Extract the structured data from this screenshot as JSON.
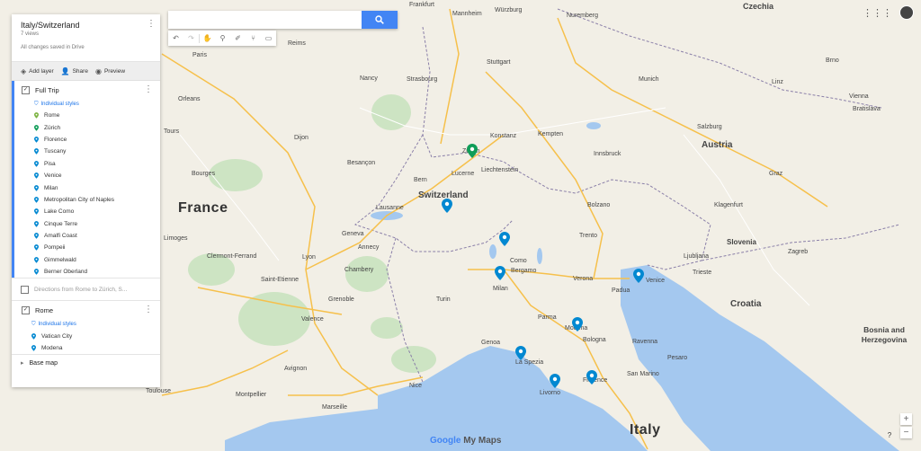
{
  "map_title": "Italy/Switzerland",
  "views": "7 views",
  "save_status": "All changes saved in Drive",
  "toolbar": {
    "add_layer": "Add layer",
    "share": "Share",
    "preview": "Preview"
  },
  "layers": [
    {
      "title": "Full Trip",
      "styles_label": "Individual styles",
      "items": [
        {
          "label": "Rome",
          "color": "#7cb342"
        },
        {
          "label": "Zürich",
          "color": "#0f9d58"
        },
        {
          "label": "Florence",
          "color": "#0288d1"
        },
        {
          "label": "Tuscany",
          "color": "#0288d1"
        },
        {
          "label": "Pisa",
          "color": "#0288d1"
        },
        {
          "label": "Venice",
          "color": "#0288d1"
        },
        {
          "label": "Milan",
          "color": "#0288d1"
        },
        {
          "label": "Metropolitan City of Naples",
          "color": "#0288d1"
        },
        {
          "label": "Lake Como",
          "color": "#0288d1"
        },
        {
          "label": "Cinque Terre",
          "color": "#0288d1"
        },
        {
          "label": "Amalfi Coast",
          "color": "#0288d1"
        },
        {
          "label": "Pompeii",
          "color": "#0288d1"
        },
        {
          "label": "Gimmelwald",
          "color": "#0288d1"
        },
        {
          "label": "Berner Oberland",
          "color": "#0288d1"
        }
      ]
    },
    {
      "title": "Rome",
      "styles_label": "Individual styles",
      "items": [
        {
          "label": "Vatican City",
          "color": "#0288d1"
        },
        {
          "label": "Modena",
          "color": "#0288d1"
        }
      ]
    }
  ],
  "directions_label": "Directions from Rome to Zürich, S...",
  "base_map_label": "Base map",
  "search": {
    "placeholder": "",
    "value": ""
  },
  "logo": {
    "brand": "Google",
    "product": " My Maps"
  },
  "colors": {
    "accent": "#4285f4",
    "water": "#a4c8ef",
    "land": "#f2efe6",
    "park": "#cde4c3"
  },
  "map_labels": {
    "countries": [
      "France",
      "Switzerland",
      "Italy",
      "Austria",
      "Croatia",
      "Slovenia",
      "Czechia",
      "Liechtenstein",
      "Bosnia and Herzegovina"
    ],
    "cities": [
      "Paris",
      "Strasbourg",
      "Stuttgart",
      "Munich",
      "Nuremberg",
      "Mannheim",
      "Würzburg",
      "Frankfurt",
      "Salzburg",
      "Vienna",
      "Bratislava",
      "Graz",
      "Zagreb",
      "Ljubljana",
      "Klagenfurt",
      "Innsbruck",
      "Bolzano",
      "Trento",
      "Verona",
      "Padua",
      "Venice",
      "Trieste",
      "Bergamo",
      "Milan",
      "Como",
      "Turin",
      "Genoa",
      "La Spezia",
      "Livorno",
      "Florence",
      "Bologna",
      "Modena",
      "Parma",
      "Ravenna",
      "San Marino",
      "Pesaro",
      "Bern",
      "Zürich",
      "Lucerne",
      "Geneva",
      "Lausanne",
      "Annecy",
      "Chambery",
      "Grenoble",
      "Lyon",
      "Dijon",
      "Besançon",
      "Nancy",
      "Reims",
      "Orleans",
      "Tours",
      "Limoges",
      "Clermont-Ferrand",
      "Saint-Etienne",
      "Valence",
      "Avignon",
      "Montpellier",
      "Marseille",
      "Nice",
      "Toulouse",
      "Bourges",
      "Brno",
      "Linz",
      "Kempten",
      "Konstanz"
    ]
  }
}
